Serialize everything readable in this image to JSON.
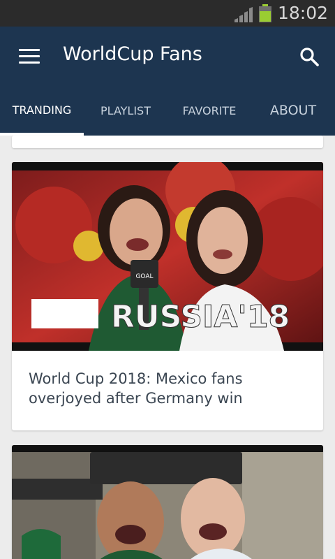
{
  "status_bar": {
    "time": "18:02",
    "signal_icon": "signal-icon",
    "battery_icon": "battery-icon"
  },
  "app_bar": {
    "title": "WorldCup Fans",
    "menu_icon": "menu-icon",
    "search_icon": "search-icon"
  },
  "tabs": [
    {
      "label": "TRANDING",
      "active": true
    },
    {
      "label": "PLAYLIST",
      "active": false
    },
    {
      "label": "FAVORITE",
      "active": false
    },
    {
      "label": "ABOUT",
      "active": false
    }
  ],
  "videos": [
    {
      "title": "World Cup 2018: Mexico fans overjoyed after Germany win",
      "overlay_text": "RUSSIA'18",
      "badge_text": "GOAL"
    }
  ],
  "colors": {
    "app_bar": "#1d3550",
    "status_bar": "#2b2b2b",
    "background": "#ececec",
    "battery": "#9acd32"
  }
}
